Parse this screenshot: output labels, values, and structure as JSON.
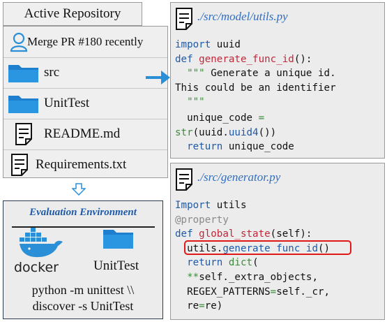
{
  "repository": {
    "tab_label": "Active Repository",
    "items": [
      {
        "label": "Merge PR #180 recently",
        "icon": "user-icon"
      },
      {
        "label": "src",
        "icon": "folder-icon"
      },
      {
        "label": "UnitTest",
        "icon": "folder-icon"
      },
      {
        "label": "README.md",
        "icon": "document-icon"
      },
      {
        "label": "Requirements.txt",
        "icon": "document-icon"
      }
    ]
  },
  "evaluation": {
    "title": "Evaluation Environment",
    "docker_label": "docker",
    "folder_label": "UnitTest",
    "command_line1": "python -m unittest \\\\",
    "command_line2": "discover -s UnitTest"
  },
  "code_panels": [
    {
      "path": "./src/model/utils.py",
      "lines": [
        "import uuid",
        "def generate_func_id():",
        "  \"\"\" Generate a unique id.",
        "This could be an identifier",
        "  \"\"\"",
        "  unique_code =",
        "str(uuid.uuid4())",
        "  return unique_code"
      ]
    },
    {
      "path": "./src/generator.py",
      "lines": [
        "Import utils",
        "@property",
        "def global_state(self):",
        "  utils.generate_func_id()",
        "  return dict(",
        "  **self._extra_objects,",
        "  REGEX_PATTERNS=self._cr,",
        "  re=re)"
      ]
    }
  ],
  "colors": {
    "keyword": "#1f5aa8",
    "function": "#c0283a",
    "string": "#3d8b3d",
    "decorator": "#8a8a8a",
    "highlight": "#e01818",
    "arrow": "#2a8fd6",
    "eval_title": "#1f5aa8"
  }
}
